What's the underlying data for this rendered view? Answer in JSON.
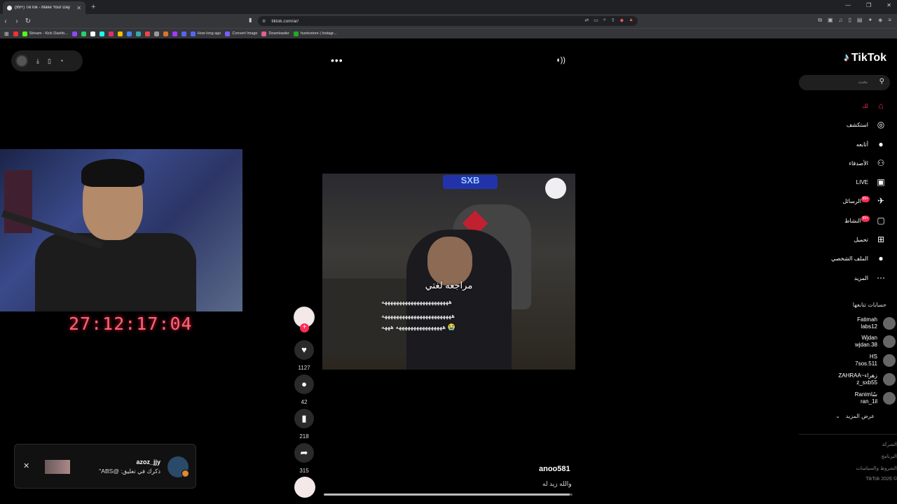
{
  "browser": {
    "tab_title": "(99+) TikTok - Make Your Day",
    "url": "tiktok.com/ar/",
    "new_tab_glyph": "+",
    "bookmarks": [
      {
        "label": "",
        "color": "#e33"
      },
      {
        "label": "Stream - Kick Dashb...",
        "color": "#53fc18"
      },
      {
        "label": "",
        "color": "#9147ff"
      },
      {
        "label": "",
        "color": "#25d366"
      },
      {
        "label": "",
        "color": "#fff"
      },
      {
        "label": "",
        "color": "#25f4ee"
      },
      {
        "label": "",
        "color": "#e1306c"
      },
      {
        "label": "",
        "color": "#f0c000"
      },
      {
        "label": "",
        "color": "#4285f4"
      },
      {
        "label": "",
        "color": "#3aa"
      },
      {
        "label": "",
        "color": "#e44"
      },
      {
        "label": "",
        "color": "#999"
      },
      {
        "label": "",
        "color": "#e07030"
      },
      {
        "label": "",
        "color": "#a03aff"
      },
      {
        "label": "",
        "color": "#5865f2"
      },
      {
        "label": "How long ago",
        "color": "#5865f2"
      },
      {
        "label": "Convert Image",
        "color": "#7b5cff"
      },
      {
        "label": "Downloader",
        "color": "#e06090"
      },
      {
        "label": "huntostore | Instagr...",
        "color": "#2a2"
      }
    ]
  },
  "player": {
    "more_glyph": "•••",
    "timer": "27:12:17:04",
    "caption_title": "مراجعه لغتي",
    "caption_lines": [
      "هههههههههههههههههههههههه",
      "ههههههههههههههههههههههههه",
      "ههههههههههههههههه هههه 😭"
    ],
    "author": "anoo581",
    "description": "والله زيد له",
    "progress": 0.99,
    "likes": "1127",
    "comments": "42",
    "saves": "218",
    "shares": "315"
  },
  "toast": {
    "close_glyph": "✕",
    "name": "azoz_jjy",
    "message": "ذكرك في تعليق: @ABS\""
  },
  "sidebar": {
    "logo_text": "TikTok",
    "search_placeholder": "بحث",
    "nav": [
      {
        "label": "لك",
        "icon": "home-icon",
        "glyph": "⌂",
        "color": "#fe2c55",
        "badge": ""
      },
      {
        "label": "استكشف",
        "icon": "compass-icon",
        "glyph": "◎",
        "color": "#fff",
        "badge": ""
      },
      {
        "label": "أتابعه",
        "icon": "following-avatar-icon",
        "glyph": "●",
        "color": "#fff",
        "badge": ""
      },
      {
        "label": "الأصدقاء",
        "icon": "friends-icon",
        "glyph": "⚇",
        "color": "#fff",
        "badge": ""
      },
      {
        "label": "LIVE",
        "icon": "live-icon",
        "glyph": "▣",
        "color": "#fff",
        "badge": ""
      },
      {
        "label": "الرسائل",
        "icon": "messages-icon",
        "glyph": "✈",
        "color": "#fff",
        "badge": "99+"
      },
      {
        "label": "النشاط",
        "icon": "activity-icon",
        "glyph": "▢",
        "color": "#fff",
        "badge": "99+"
      },
      {
        "label": "تحميل",
        "icon": "upload-icon",
        "glyph": "⊞",
        "color": "#fff",
        "badge": ""
      },
      {
        "label": "الملف الشخصي",
        "icon": "profile-icon",
        "glyph": "●",
        "color": "#fff",
        "badge": ""
      },
      {
        "label": "المزيد",
        "icon": "more-icon",
        "glyph": "⋯",
        "color": "#fff",
        "badge": ""
      }
    ],
    "following_title": "حسابات تتابعها",
    "following": [
      {
        "name": "Fatimah",
        "handle": "labs12"
      },
      {
        "name": "Wjdan",
        "handle": "wjdan.38"
      },
      {
        "name": "HS",
        "handle": "7sos.511"
      },
      {
        "name": "ZAHRAA~زهراء",
        "handle": "z_sxb55"
      },
      {
        "name": "Ranimسًا",
        "handle": "ran_1il"
      }
    ],
    "see_more": "عرض المزيد",
    "footer": [
      "الشركة",
      "البرنامج",
      "الشروط والسياسات",
      "© 2026 TikTok"
    ]
  }
}
